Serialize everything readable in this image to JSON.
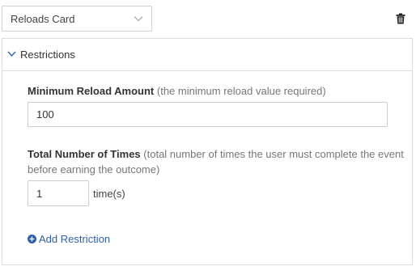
{
  "card_select": {
    "value": "Reloads Card",
    "icon": "chevron-down-icon"
  },
  "delete_icon": "trash-icon",
  "restrictions": {
    "title": "Restrictions",
    "expanded": true,
    "min_reload": {
      "label": "Minimum Reload Amount",
      "hint": "(the minimum reload value required)",
      "value": "100"
    },
    "total_times": {
      "label": "Total Number of Times",
      "hint_line1": "(total number of times the user must complete the event",
      "hint_line2": "before earning the outcome)",
      "value": "1",
      "unit": "time(s)"
    },
    "add_label": "Add Restriction"
  },
  "colors": {
    "link": "#2f5fa8",
    "border": "#dcdcdc",
    "hint": "#777777"
  }
}
